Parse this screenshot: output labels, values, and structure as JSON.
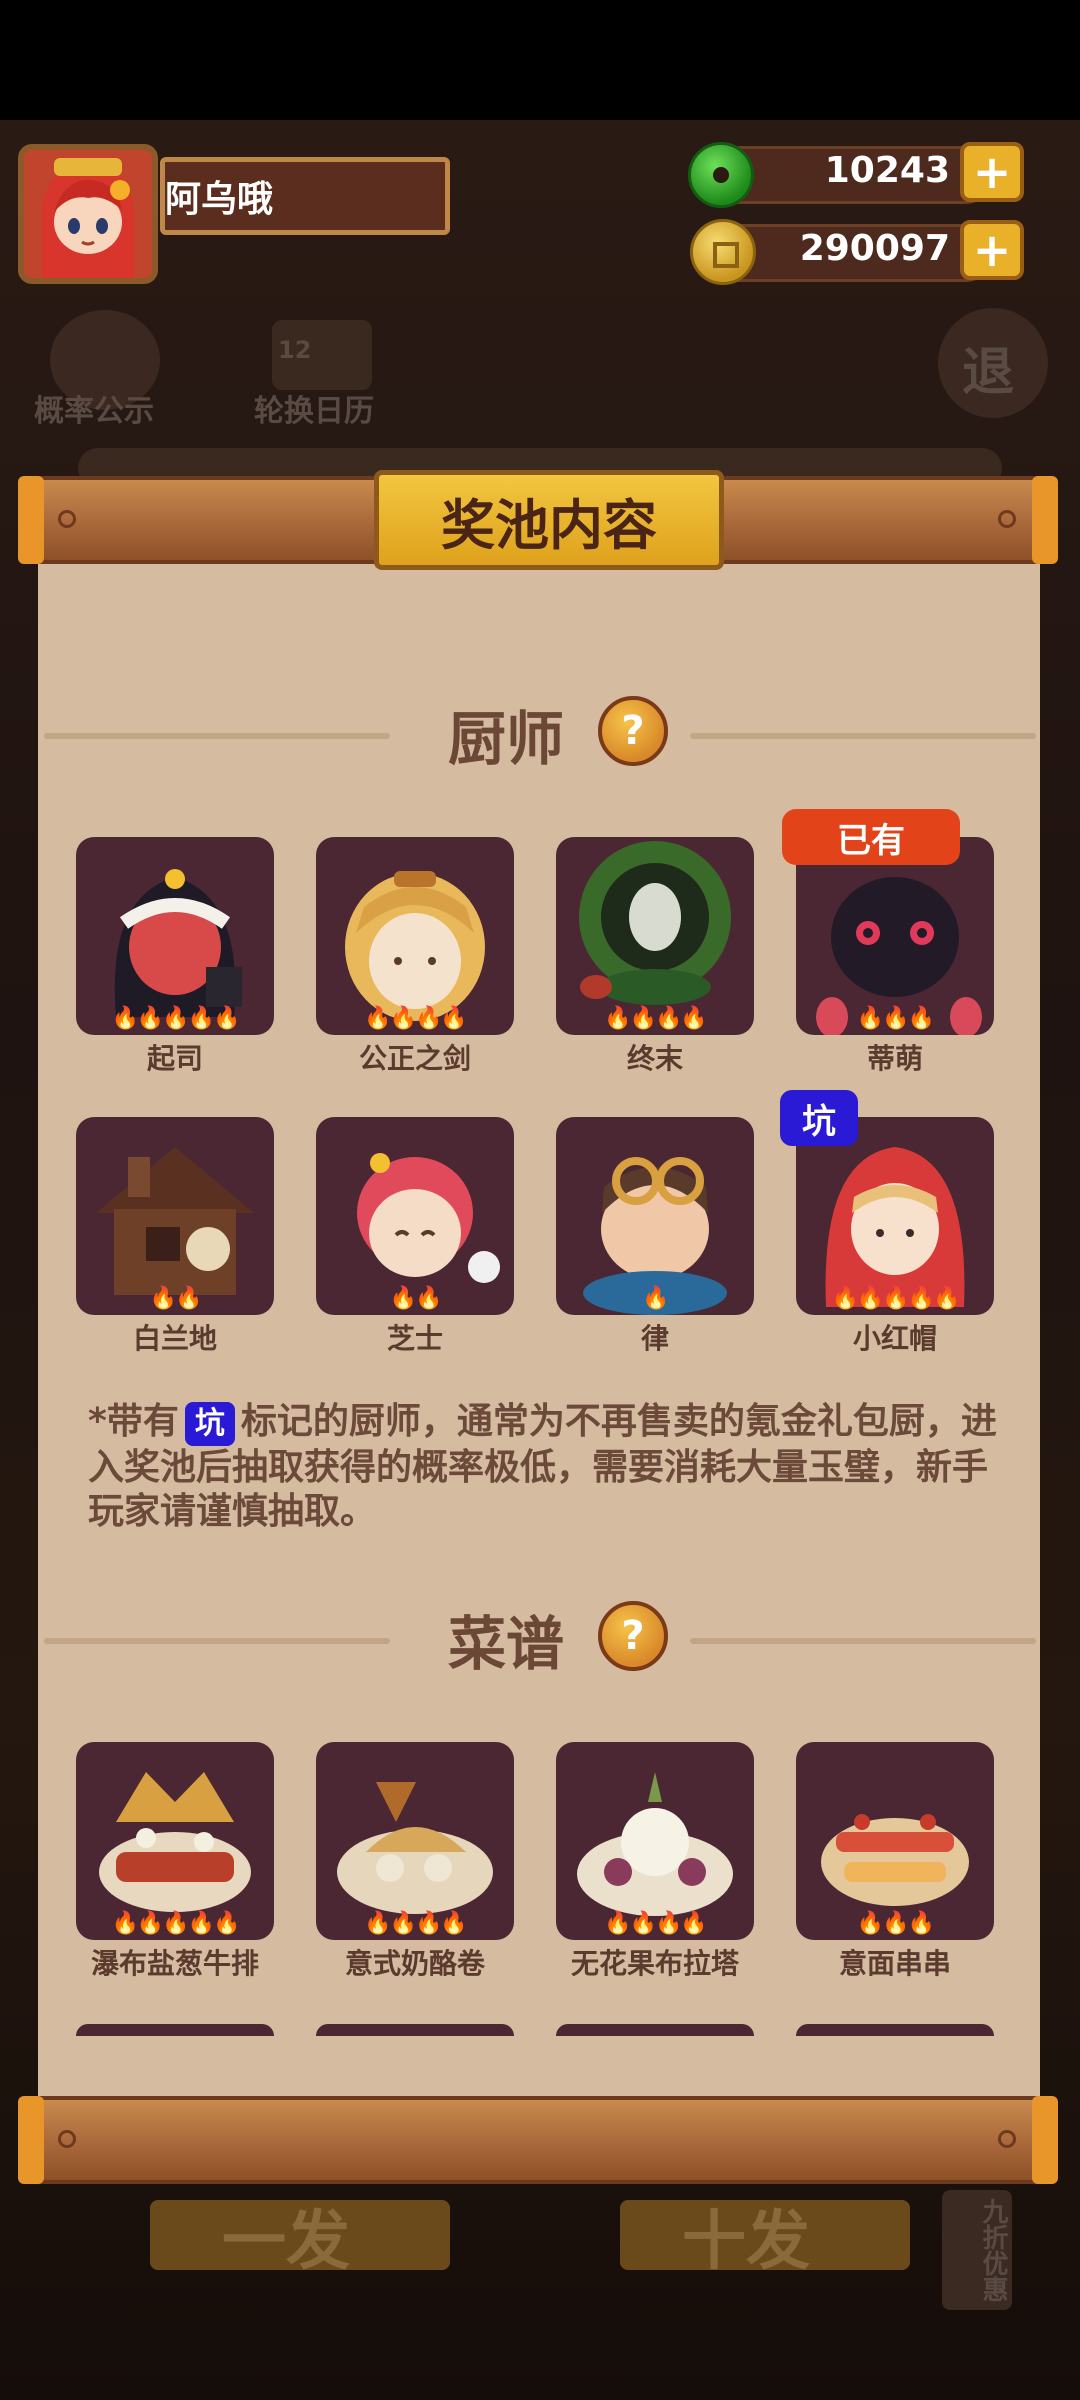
{
  "player": {
    "name": "阿乌哦"
  },
  "currencies": {
    "jade": {
      "value": "10243",
      "icon": "jade-icon"
    },
    "coins": {
      "value": "290097",
      "icon": "coin-icon"
    },
    "plus_label": "+"
  },
  "background_menu": {
    "probability": "概率公示",
    "calendar": "轮换日历",
    "calendar_day": "12",
    "exit": "退",
    "discount": "九折优惠",
    "single_draw": "一发",
    "ten_draw": "十发"
  },
  "panel": {
    "title": "奖池内容",
    "chef_section": "厨师",
    "recipe_section": "菜谱",
    "help_label": "?",
    "owned_badge": "已有",
    "pit_badge": "坑",
    "flame_glyph": "🔥"
  },
  "chefs": [
    {
      "name": "起司",
      "stars": 5
    },
    {
      "name": "公正之剑",
      "stars": 4
    },
    {
      "name": "终末",
      "stars": 4
    },
    {
      "name": "蒂萌",
      "stars": 3,
      "owned": true
    },
    {
      "name": "白兰地",
      "stars": 2
    },
    {
      "name": "芝士",
      "stars": 2
    },
    {
      "name": "律",
      "stars": 1
    },
    {
      "name": "小红帽",
      "stars": 5,
      "pit": true
    }
  ],
  "note": {
    "prefix": "*带有",
    "body": "标记的厨师，通常为不再售卖的氪金礼包厨，进入奖池后抽取获得的概率极低，需要消耗大量玉璧，新手玩家请谨慎抽取。"
  },
  "recipes": [
    {
      "name": "瀑布盐葱牛排",
      "stars": 5
    },
    {
      "name": "意式奶酪卷",
      "stars": 4
    },
    {
      "name": "无花果布拉塔",
      "stars": 4
    },
    {
      "name": "意面串串",
      "stars": 3
    }
  ],
  "colors": {
    "panel_bg": "#d5bba0",
    "card_bg": "#4a2733",
    "owned_badge": "#e34318",
    "pit_badge": "#2a1ad6",
    "gold": "#e9b02a"
  }
}
